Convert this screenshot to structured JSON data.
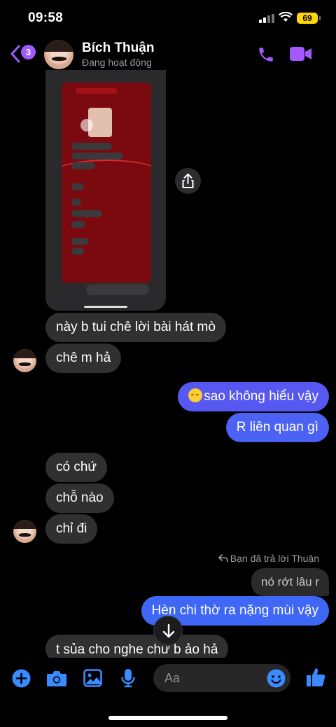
{
  "status": {
    "time": "09:58",
    "battery": "69"
  },
  "header": {
    "unread_count": "3",
    "name": "Bích Thuận",
    "presence": "Đang hoạt động",
    "accent": "#a259ff"
  },
  "shared_screenshot": {
    "icon": "share-icon"
  },
  "messages": [
    {
      "side": "in",
      "text": "này b tui chê lời bài hát mò"
    },
    {
      "side": "in",
      "text": "chê m hả"
    },
    {
      "side": "out",
      "text": "sao không hiểu vậy",
      "emoji": "relieved-face"
    },
    {
      "side": "out",
      "text": "R liên quan gì"
    },
    {
      "side": "in",
      "text": "có chứ"
    },
    {
      "side": "in",
      "text": "chỗ nào"
    },
    {
      "side": "in",
      "text": "chỉ đi"
    },
    {
      "side": "out",
      "text": "Hèn chi thờ ra nặng mùi vậy"
    },
    {
      "side": "in",
      "text": "t sủa cho nghe chư b ảo hả"
    }
  ],
  "reply": {
    "note": "Bạn đã trả lời Thuận",
    "quoted": "nó rớt lâu r"
  },
  "composer": {
    "placeholder": "Aa",
    "accent": "#3a8bff"
  },
  "colors": {
    "outgoing": "#4f5cf5",
    "incoming": "#303030"
  }
}
